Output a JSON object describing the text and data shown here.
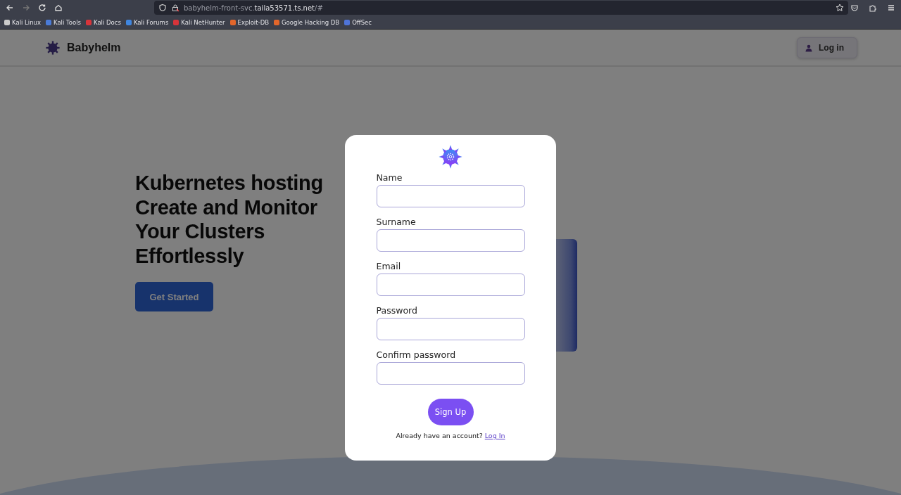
{
  "browser": {
    "url_path": "babyhelm-front-svc.",
    "url_host": "taila53571.ts.net",
    "url_suffix": "/#",
    "bookmarks": [
      {
        "label": "Kali Linux",
        "color": "#cccccc"
      },
      {
        "label": "Kali Tools",
        "color": "#4a7bd8"
      },
      {
        "label": "Kali Docs",
        "color": "#d8343a"
      },
      {
        "label": "Kali Forums",
        "color": "#3f86e0"
      },
      {
        "label": "Kali NetHunter",
        "color": "#d8343a"
      },
      {
        "label": "Exploit-DB",
        "color": "#e2662b"
      },
      {
        "label": "Google Hacking DB",
        "color": "#e2662b"
      },
      {
        "label": "OffSec",
        "color": "#4f74d9"
      }
    ]
  },
  "header": {
    "brand": "Babyhelm",
    "login_button": "Log in"
  },
  "hero": {
    "headline": [
      "Kubernetes hosting",
      "Create and Monitor",
      "Your Clusters",
      "Effortlessly"
    ],
    "cta": "Get Started"
  },
  "signup_modal": {
    "fields": [
      {
        "label": "Name"
      },
      {
        "label": "Surname"
      },
      {
        "label": "Email"
      },
      {
        "label": "Password"
      },
      {
        "label": "Confirm password"
      }
    ],
    "submit": "Sign Up",
    "footer_text": "Already have an account?",
    "footer_link": "Log In"
  }
}
